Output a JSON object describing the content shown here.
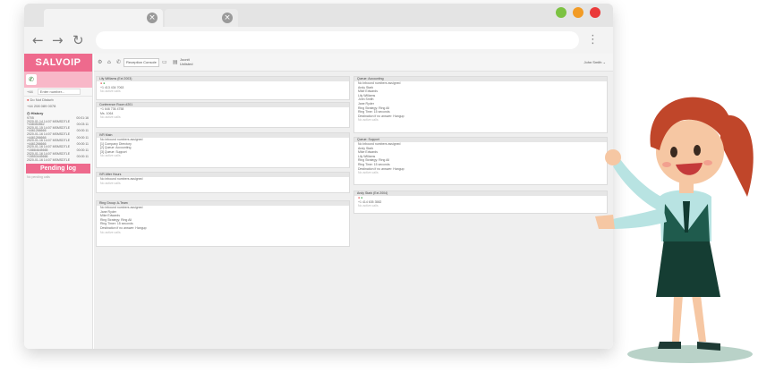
{
  "app": {
    "logo": "SALVOIP"
  },
  "toolbar": {
    "reception": "Reception Console",
    "workstation": [
      "Joonit",
      "Unlisted"
    ],
    "user": "John Smith ⌄"
  },
  "sidebar": {
    "dial_prefix": "+44",
    "dial_placeholder": "Enter number...",
    "status": "Do Not Disturb",
    "number": "+44 208 089 0078",
    "history_label": "History",
    "history": [
      {
        "n": "9705",
        "d": "2020-01-14 14:07 MSMSDTLE",
        "t": "00:01:16"
      },
      {
        "n": "+448454562",
        "d": "2020-01-15 14:07 MSMSDTLE",
        "t": "00:03:11"
      },
      {
        "n": "+4461266666",
        "d": "2020-01-16 14:07 MSMSDTLE",
        "t": "00:00:11"
      },
      {
        "n": "+4461266666",
        "d": "2020-01-16 14:07 MSMSDTLE",
        "t": "00:00:11"
      },
      {
        "n": "+4461266666",
        "d": "2020-01-16 14:07 MSMSDTLE",
        "t": "00:00:11"
      },
      {
        "n": "+15884645665",
        "d": "2020-01-16 14:07 MSMSDTLE",
        "t": "00:00:11"
      },
      {
        "n": "+15553445666",
        "d": "2020-01-16 14:07 MSMSDTLE",
        "t": "00:00:11"
      }
    ],
    "pending_label": "Pending log",
    "no_pending": "No pending calls"
  },
  "panels": {
    "left": [
      {
        "title": "Lily Williams (Ext 2003)",
        "lines": [
          "+1 413 434 7063",
          "No active calls"
        ]
      },
      {
        "title": "Conference Room #201",
        "lines": [
          "+1 646 736 4758",
          "Ms. 1064",
          "No active calls"
        ]
      },
      {
        "title": "IVR Main",
        "lines": [
          "No inbound numbers assigned",
          "[1] Company Directory",
          "[2] Queue: Accounting",
          "[3] Queue: Support",
          "No active calls"
        ]
      },
      {
        "title": "IVR After Hours",
        "lines": [
          "No inbound numbers assigned",
          "No active calls"
        ]
      },
      {
        "title": "Ring Group: A-Team",
        "lines": [
          "No inbound numbers assigned",
          "Jane Ryder",
          "Mike Edwards",
          "Ring Strategy: Ring All",
          "Ring Timer: 15 seconds",
          "Destination if no answer: Hangup",
          "No active calls"
        ]
      }
    ],
    "right": [
      {
        "title": "Queue: Accounting",
        "lines": [
          "No inbound numbers assigned",
          "Andy Stark",
          "Mike Edwards",
          "Lily Williams",
          "John Smith",
          "Jane Ryder",
          "Ring Strategy: Ring All",
          "Ring Time: 15 seconds",
          "Destination if no answer: Hangup",
          "No active calls"
        ]
      },
      {
        "title": "Queue: Support",
        "lines": [
          "No inbound numbers assigned",
          "Andy Stark",
          "Mike Edwards",
          "Lily Williams",
          "Ring Strategy: Ring All",
          "Ring Time: 15 seconds",
          "Destination if no answer: Hangup",
          "No active calls"
        ]
      },
      {
        "title": "Andy Stark (Ext 2004)",
        "lines": [
          "",
          "+1 414 635 3582",
          "No active calls"
        ]
      }
    ]
  },
  "colors": {
    "brand": "#ee6a8d",
    "brand_light": "#f8b7c8",
    "win_green": "#7cc242",
    "win_orange": "#f29b25",
    "win_red": "#ea3a3a"
  },
  "icons": [
    "tab-close-icon",
    "back-arrow-icon",
    "forward-arrow-icon",
    "reload-icon",
    "kebab-menu-icon",
    "phone-icon",
    "history-icon",
    "user-icon"
  ]
}
